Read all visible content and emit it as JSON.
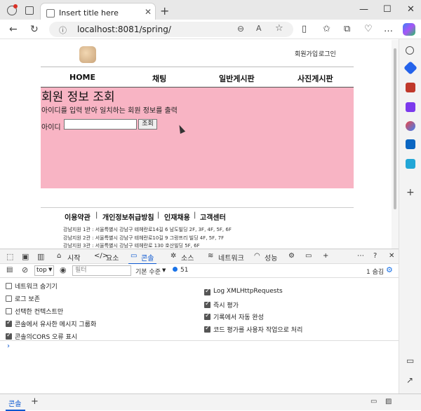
{
  "browser": {
    "tab_title": "Insert title here",
    "url": "localhost:8081/spring/",
    "new_tab": "+"
  },
  "site": {
    "top_links": [
      "회원가입",
      "로그인"
    ],
    "menu": [
      "HOME",
      "채팅",
      "일반게시판",
      "사진게시판"
    ],
    "section_title": "회원 정보 조회",
    "section_desc": "아이디를 입력 받아 일치하는 회원 정보를 출력",
    "id_label": "아이디 :",
    "id_value": "",
    "search_button": "조회",
    "footer_links": [
      "이용약관",
      "개인정보취급방침",
      "인재채용",
      "고객센터"
    ],
    "footer_sep": "|",
    "addresses": [
      "강남지원 1관 : 서울특별시 강남구 테헤란로14길 6 남도빌딩 2F, 3F, 4F, 5F, 6F",
      "강남지원 2관 : 서울특별시 강남구 테헤란로10길 9 그랑프리 빌딩 4F, 5F, 7F",
      "강남지원 3관 : 서울특별시 강남구 테헤란로 130 호산빌딩 5F, 6F"
    ],
    "pink_color": "#f8b4c4"
  },
  "devtools": {
    "tabs": [
      "시작",
      "요소",
      "콘솔",
      "소스",
      "네트워크",
      "성능"
    ],
    "active_tab": "콘솔",
    "context": "top",
    "filter_placeholder": "필터",
    "level": "기본 수준",
    "message_count": "51",
    "issues": "1 숨김",
    "settings_left": [
      {
        "label": "네트워크 숨기기",
        "checked": false
      },
      {
        "label": "로그 보존",
        "checked": false
      },
      {
        "label": "선택한 컨텍스트만",
        "checked": false
      },
      {
        "label": "콘솔에서 유사한 메시지 그룹화",
        "checked": true
      },
      {
        "label": "콘솔의CORS 오류 표시",
        "checked": true
      }
    ],
    "settings_right": [
      {
        "label": "Log XMLHttpRequests",
        "checked": true
      },
      {
        "label": "즉시 평가",
        "checked": true
      },
      {
        "label": "기록에서 자동 완성",
        "checked": true
      },
      {
        "label": "코드 평가를 사용자 작업으로 처리",
        "checked": true
      }
    ],
    "prompt": "›",
    "drawer_tab": "콘솔",
    "drawer_add": "+"
  }
}
